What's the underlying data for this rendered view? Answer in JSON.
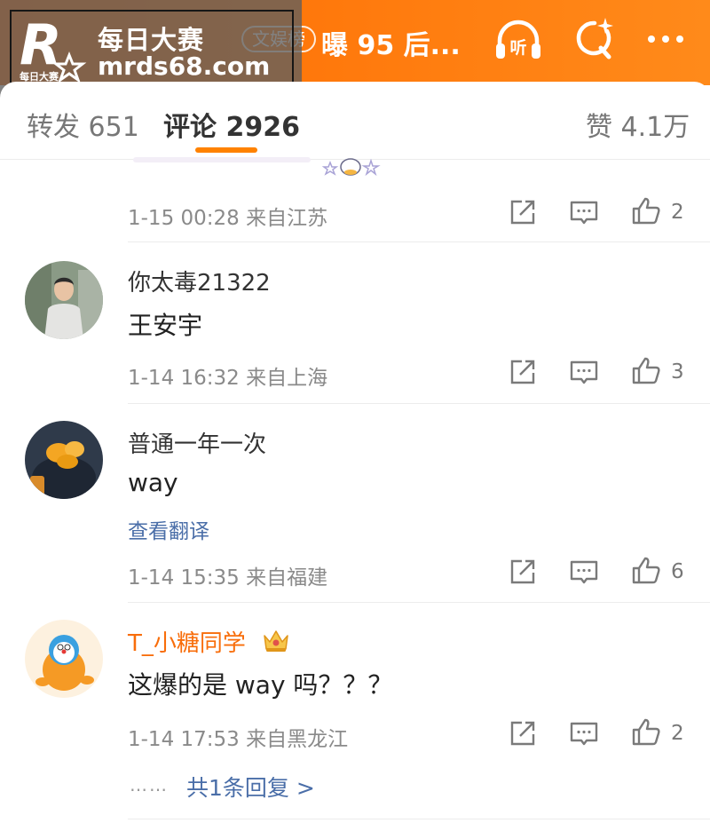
{
  "watermark": {
    "logo_letter": "R",
    "logo_caption": "每日大赛",
    "name": "每日大赛",
    "url": "mrds68.com"
  },
  "header": {
    "tag": "文娱榜",
    "headline": "曝 95 后...",
    "icons": {
      "listen": "headphone-icon",
      "listen_label": "听",
      "search": "search-sparkle-icon",
      "more": "more-icon"
    }
  },
  "tabs": {
    "repost": "转发 651",
    "comments": "评论 2926",
    "likes": "赞 4.1万"
  },
  "colors": {
    "accent": "#ff8200",
    "link": "#4a6ea8",
    "vip_name": "#f86d0a"
  },
  "comments": [
    {
      "time": "1-15 00:28",
      "source": "来自江苏",
      "likes": "2"
    },
    {
      "user": "你太毒21322",
      "text": "王安宇",
      "time": "1-14 16:32",
      "source": "来自上海",
      "likes": "3"
    },
    {
      "user": "普通一年一次",
      "text": "way",
      "translate": "查看翻译",
      "time": "1-14 15:35",
      "source": "来自福建",
      "likes": "6"
    },
    {
      "user": "T_小糖同学",
      "text": "这爆的是 way 吗？？？",
      "time": "1-14 17:53",
      "source": "来自黑龙江",
      "likes": "2",
      "dots": "……",
      "replies": "共1条回复 >"
    }
  ]
}
